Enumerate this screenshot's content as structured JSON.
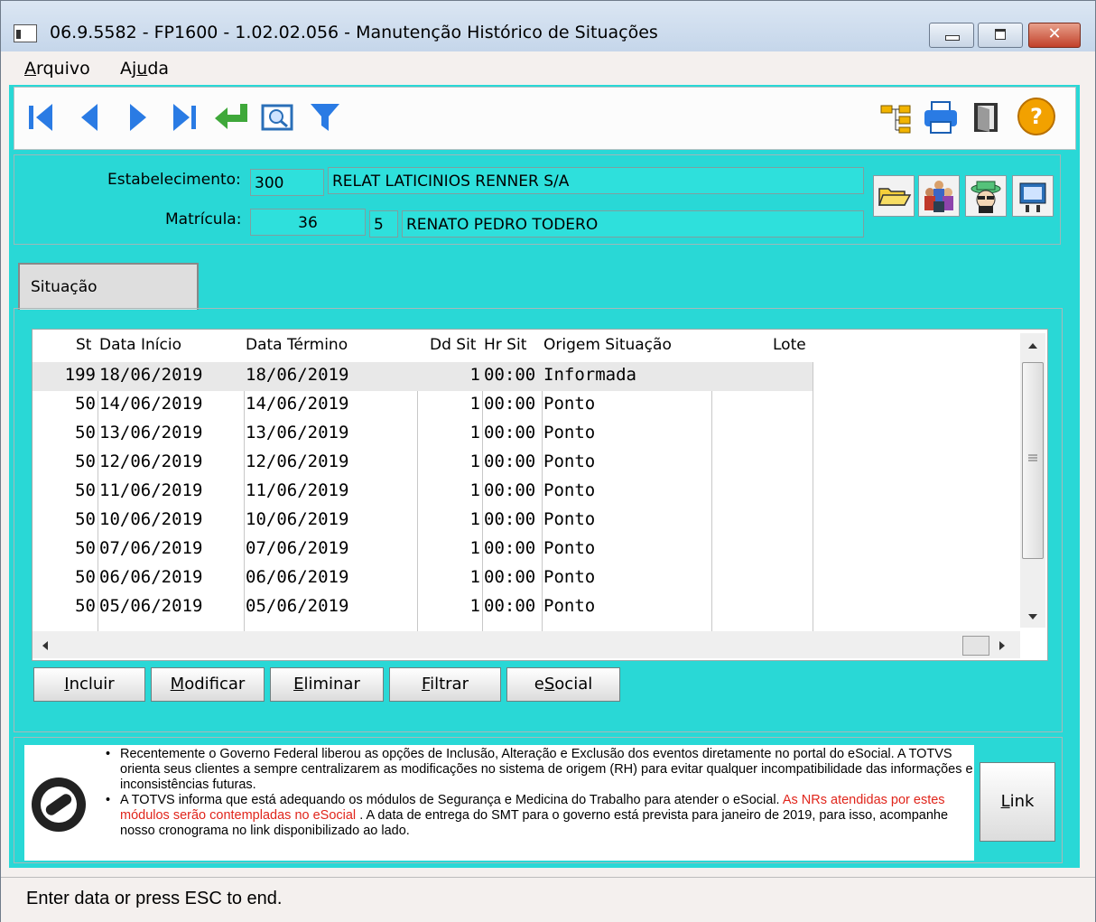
{
  "window": {
    "title": "06.9.5582 - FP1600 - 1.02.02.056 - Manutenção Histórico de Situações",
    "close_glyph": "✕"
  },
  "menu": {
    "arquivo": {
      "pre": "",
      "hot": "A",
      "post": "rquivo"
    },
    "ajuda": {
      "pre": "Aj",
      "hot": "u",
      "post": "da"
    }
  },
  "header": {
    "estabelecimento_label": "Estabelecimento:",
    "estabelecimento_code": "300",
    "estabelecimento_name": "RELAT LATICINIOS RENNER S/A",
    "matricula_label": "Matrícula:",
    "matricula_number": "36",
    "matricula_digit": "5",
    "employee_name": "RENATO PEDRO TODERO"
  },
  "tab": {
    "label": "Situação"
  },
  "grid": {
    "columns": [
      "St",
      "Data Início",
      "Data Término",
      "Dd Sit",
      "Hr Sit",
      "Origem Situação",
      "Lote"
    ],
    "rows": [
      {
        "st": "199",
        "inicio": "18/06/2019",
        "termino": "18/06/2019",
        "dd": "1",
        "hr": "00:00",
        "origem": "Informada",
        "lote": ""
      },
      {
        "st": "50",
        "inicio": "14/06/2019",
        "termino": "14/06/2019",
        "dd": "1",
        "hr": "00:00",
        "origem": "Ponto",
        "lote": ""
      },
      {
        "st": "50",
        "inicio": "13/06/2019",
        "termino": "13/06/2019",
        "dd": "1",
        "hr": "00:00",
        "origem": "Ponto",
        "lote": ""
      },
      {
        "st": "50",
        "inicio": "12/06/2019",
        "termino": "12/06/2019",
        "dd": "1",
        "hr": "00:00",
        "origem": "Ponto",
        "lote": ""
      },
      {
        "st": "50",
        "inicio": "11/06/2019",
        "termino": "11/06/2019",
        "dd": "1",
        "hr": "00:00",
        "origem": "Ponto",
        "lote": ""
      },
      {
        "st": "50",
        "inicio": "10/06/2019",
        "termino": "10/06/2019",
        "dd": "1",
        "hr": "00:00",
        "origem": "Ponto",
        "lote": ""
      },
      {
        "st": "50",
        "inicio": "07/06/2019",
        "termino": "07/06/2019",
        "dd": "1",
        "hr": "00:00",
        "origem": "Ponto",
        "lote": ""
      },
      {
        "st": "50",
        "inicio": "06/06/2019",
        "termino": "06/06/2019",
        "dd": "1",
        "hr": "00:00",
        "origem": "Ponto",
        "lote": ""
      },
      {
        "st": "50",
        "inicio": "05/06/2019",
        "termino": "05/06/2019",
        "dd": "1",
        "hr": "00:00",
        "origem": "Ponto",
        "lote": ""
      }
    ]
  },
  "buttons": {
    "incluir": {
      "pre": "",
      "hot": "I",
      "post": "ncluir"
    },
    "modificar": {
      "pre": "",
      "hot": "M",
      "post": "odificar"
    },
    "eliminar": {
      "pre": "",
      "hot": "E",
      "post": "liminar"
    },
    "filtrar": {
      "pre": "",
      "hot": "F",
      "post": "iltrar"
    },
    "esocial": {
      "pre": "e",
      "hot": "S",
      "post": "ocial"
    },
    "link": {
      "pre": "",
      "hot": "L",
      "post": "ink"
    }
  },
  "info": {
    "bullet1": "Recentemente o Governo Federal liberou as opções de Inclusão, Alteração e Exclusão dos eventos diretamente no portal do eSocial. A TOTVS orienta seus clientes a sempre centralizarem as modificações no sistema de origem (RH) para evitar qualquer incompatibilidade das informações e inconsistências futuras.",
    "bullet2_a": "A TOTVS informa que está adequando os módulos de Segurança e Medicina do Trabalho para atender o eSocial.",
    "bullet2_red": "As NRs atendidas por estes módulos serão contempladas no eSocial",
    "bullet2_b": ". A data de entrega do SMT para o governo está prevista para janeiro de 2019, para isso, acompanhe nosso cronograma no link disponibilizado ao lado."
  },
  "status": {
    "text": "Enter data or press ESC to end."
  },
  "colors": {
    "client_bg": "#29d8d6",
    "field_bg": "#2ee0dc",
    "accent_red": "#e0251b",
    "nav_blue": "#1a73e8",
    "help_orange": "#f2a100"
  },
  "icons": [
    "first-record-icon",
    "prev-record-icon",
    "next-record-icon",
    "last-record-icon",
    "return-icon",
    "zoom-icon",
    "filter-icon",
    "tree-icon",
    "print-icon",
    "exit-door-icon",
    "help-icon",
    "folder-open-icon",
    "people-icon",
    "detective-icon",
    "film-icon",
    "totvs-logo-icon"
  ]
}
